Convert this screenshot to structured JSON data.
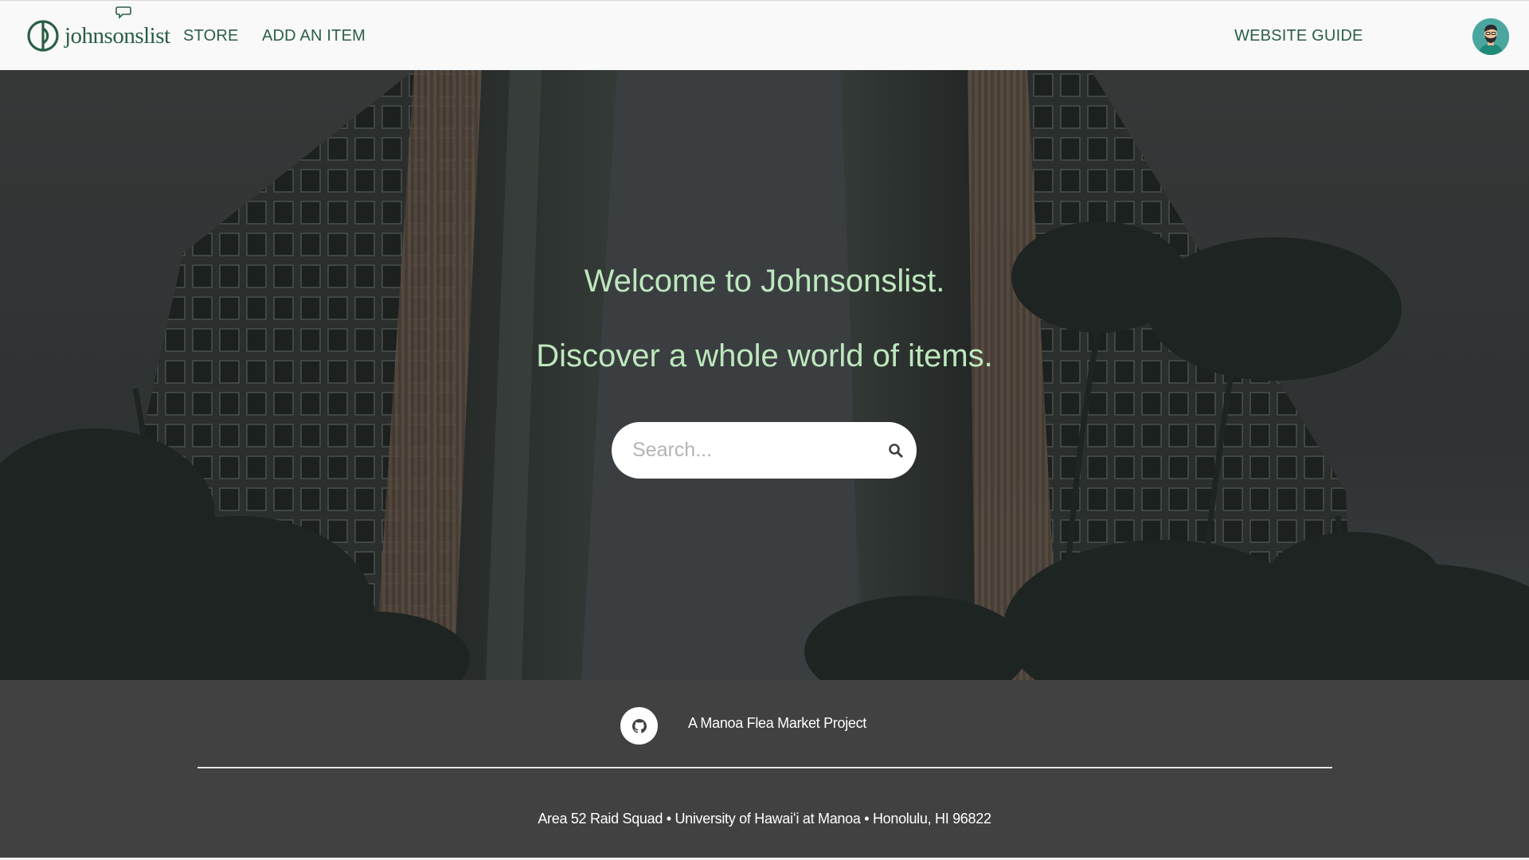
{
  "navbar": {
    "brand": "johnsonslist",
    "links": {
      "store": "STORE",
      "add_item": "ADD AN ITEM",
      "guide": "WEBSITE GUIDE"
    },
    "accent_color": "#2b5e45",
    "avatar_icon": "user-avatar-icon"
  },
  "hero": {
    "title": "Welcome to Johnsonslist.",
    "subtitle": "Discover a whole world of items.",
    "search_placeholder": "Search...",
    "search_icon": "search-icon",
    "text_color": "#bde7bd"
  },
  "footer": {
    "github_icon": "github-icon",
    "project": "A Manoa Flea Market Project",
    "address": "Area 52 Raid Squad • University of Hawaiʻi at Manoa • Honolulu, HI 96822",
    "background": "#414141"
  }
}
